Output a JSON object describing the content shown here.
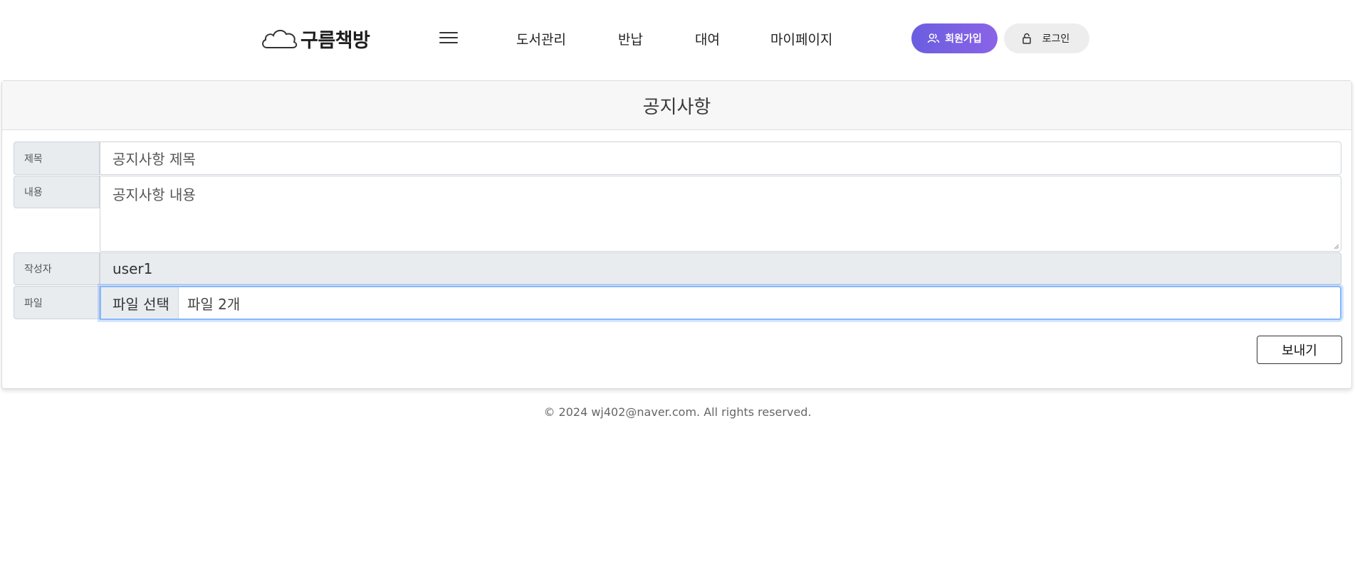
{
  "header": {
    "logo_icon": "cloud-icon",
    "logo_text": "구름책방",
    "menu_icon": "hamburger-icon",
    "nav": [
      {
        "label": "도서관리"
      },
      {
        "label": "반납"
      },
      {
        "label": "대여"
      },
      {
        "label": "마이페이지"
      }
    ],
    "signup": {
      "label": "회원가입",
      "icon": "users-icon",
      "color": "#7460e3"
    },
    "login": {
      "label": "로그인",
      "icon": "lock-icon",
      "color": "#ededed"
    }
  },
  "card": {
    "title": "공지사항",
    "fields": {
      "title": {
        "label": "제목",
        "placeholder": "공지사항 제목"
      },
      "content": {
        "label": "내용",
        "placeholder": "공지사항 내용"
      },
      "author": {
        "label": "작성자",
        "value": "user1"
      },
      "file": {
        "label": "파일",
        "button": "파일 선택",
        "status": "파일 2개"
      }
    },
    "submit_label": "보내기"
  },
  "footer": {
    "text": "© 2024 wj402@naver.com. All rights reserved."
  }
}
